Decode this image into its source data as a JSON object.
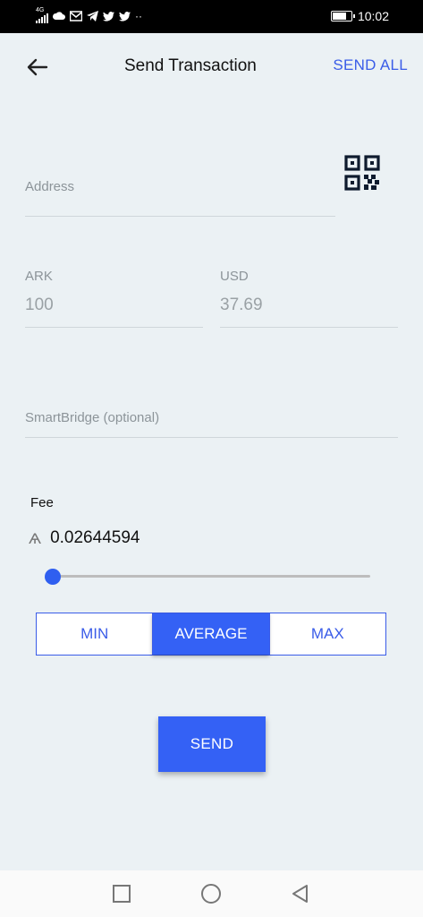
{
  "status_bar": {
    "network": "4G",
    "time": "10:02",
    "battery_level": 0.8,
    "notification_icons": [
      "signal-icon",
      "cloud-icon",
      "gmail-icon",
      "telegram-icon",
      "twitter-icon",
      "twitter-icon",
      "more-dots-icon"
    ]
  },
  "header": {
    "title": "Send Transaction",
    "send_all_label": "SEND ALL",
    "back_icon": "arrow-left-icon"
  },
  "form": {
    "address": {
      "placeholder": "Address",
      "value": ""
    },
    "qr_icon": "qr-code-icon",
    "ark": {
      "label": "ARK",
      "value": "100"
    },
    "usd": {
      "label": "USD",
      "value": "37.69"
    },
    "smartbridge": {
      "placeholder": "SmartBridge (optional)",
      "value": ""
    }
  },
  "fee": {
    "label": "Fee",
    "currency_symbol": "Ѧ",
    "value": "0.02644594",
    "slider_level": 0.0,
    "options": [
      "MIN",
      "AVERAGE",
      "MAX"
    ],
    "selected": "AVERAGE"
  },
  "send_button": {
    "label": "SEND"
  },
  "colors": {
    "accent": "#3461f5",
    "background": "#ebf1f4"
  },
  "nav_bar": {
    "icons": [
      "square-recents-icon",
      "circle-home-icon",
      "triangle-back-icon"
    ]
  }
}
